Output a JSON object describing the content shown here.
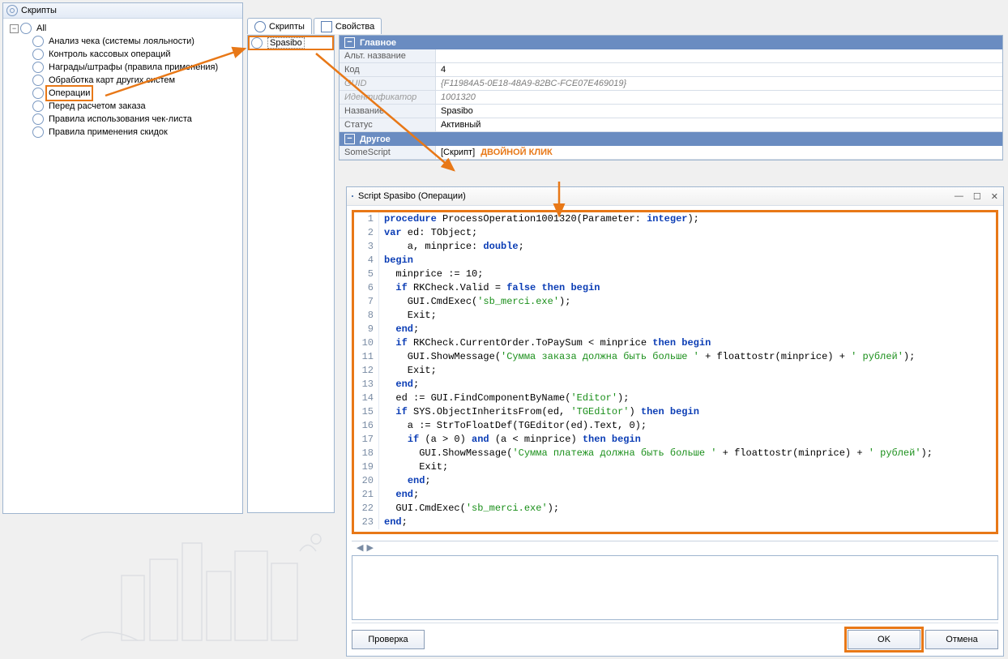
{
  "leftPanel": {
    "title": "Скрипты",
    "root": "All",
    "items": [
      "Анализ чека (системы лояльности)",
      "Контроль кассовых операций",
      "Награды/штрафы (правила применения)",
      "Обработка карт других систем",
      "Операции",
      "Перед расчетом заказа",
      "Правила использования чек-листа",
      "Правила применения скидок"
    ],
    "selectedIndex": 4
  },
  "tabs": {
    "scripts": "Скрипты",
    "properties": "Свойства"
  },
  "midPanel": {
    "item": "Spasibo"
  },
  "props": {
    "section_main": "Главное",
    "section_other": "Другое",
    "rows": {
      "alt_name_label": "Альт. название",
      "alt_name_value": "",
      "code_label": "Код",
      "code_value": "4",
      "guid_label": "GUID",
      "guid_value": "{F11984A5-0E18-48A9-82BC-FCE07E469019}",
      "id_label": "Идентификатор",
      "id_value": "1001320",
      "name_label": "Название",
      "name_value": "Spasibo",
      "status_label": "Статус",
      "status_value": "Активный",
      "somescript_label": "SomeScript",
      "somescript_value": "[Скрипт]",
      "dbl_click_hint": "ДВОЙНОЙ КЛИК"
    }
  },
  "dialog": {
    "title": "Script Spasibo (Операции)",
    "buttons": {
      "verify": "Проверка",
      "ok": "OK",
      "cancel": "Отмена"
    }
  },
  "code": [
    {
      "n": 1,
      "seg": [
        [
          "kw",
          "procedure"
        ],
        [
          "txt",
          " ProcessOperation1001320(Parameter: "
        ],
        [
          "kw",
          "integer"
        ],
        [
          "txt",
          ");"
        ]
      ]
    },
    {
      "n": 2,
      "seg": [
        [
          "kw",
          "var"
        ],
        [
          "txt",
          " ed: TObject;"
        ]
      ]
    },
    {
      "n": 3,
      "seg": [
        [
          "txt",
          "    a, minprice: "
        ],
        [
          "kw",
          "double"
        ],
        [
          "txt",
          ";"
        ]
      ]
    },
    {
      "n": 4,
      "seg": [
        [
          "kw",
          "begin"
        ]
      ]
    },
    {
      "n": 5,
      "seg": [
        [
          "txt",
          "  minprice := 10;"
        ]
      ]
    },
    {
      "n": 6,
      "seg": [
        [
          "txt",
          "  "
        ],
        [
          "kw",
          "if"
        ],
        [
          "txt",
          " RKCheck.Valid = "
        ],
        [
          "kw",
          "false"
        ],
        [
          "txt",
          " "
        ],
        [
          "kw",
          "then"
        ],
        [
          "txt",
          " "
        ],
        [
          "kw",
          "begin"
        ]
      ]
    },
    {
      "n": 7,
      "seg": [
        [
          "txt",
          "    GUI.CmdExec("
        ],
        [
          "str",
          "'sb_merci.exe'"
        ],
        [
          "txt",
          ");"
        ]
      ]
    },
    {
      "n": 8,
      "seg": [
        [
          "txt",
          "    Exit;"
        ]
      ]
    },
    {
      "n": 9,
      "seg": [
        [
          "txt",
          "  "
        ],
        [
          "kw",
          "end"
        ],
        [
          "txt",
          ";"
        ]
      ]
    },
    {
      "n": 10,
      "seg": [
        [
          "txt",
          "  "
        ],
        [
          "kw",
          "if"
        ],
        [
          "txt",
          " RKCheck.CurrentOrder.ToPaySum < minprice "
        ],
        [
          "kw",
          "then"
        ],
        [
          "txt",
          " "
        ],
        [
          "kw",
          "begin"
        ]
      ]
    },
    {
      "n": 11,
      "seg": [
        [
          "txt",
          "    GUI.ShowMessage("
        ],
        [
          "str",
          "'Сумма заказа должна быть больше '"
        ],
        [
          "txt",
          " + floattostr(minprice) + "
        ],
        [
          "str",
          "' рублей'"
        ],
        [
          "txt",
          ");"
        ]
      ]
    },
    {
      "n": 12,
      "seg": [
        [
          "txt",
          "    Exit;"
        ]
      ]
    },
    {
      "n": 13,
      "seg": [
        [
          "txt",
          "  "
        ],
        [
          "kw",
          "end"
        ],
        [
          "txt",
          ";"
        ]
      ]
    },
    {
      "n": 14,
      "seg": [
        [
          "txt",
          "  ed := GUI.FindComponentByName("
        ],
        [
          "str",
          "'Editor'"
        ],
        [
          "txt",
          ");"
        ]
      ]
    },
    {
      "n": 15,
      "seg": [
        [
          "txt",
          "  "
        ],
        [
          "kw",
          "if"
        ],
        [
          "txt",
          " SYS.ObjectInheritsFrom(ed, "
        ],
        [
          "str",
          "'TGEditor'"
        ],
        [
          "txt",
          ") "
        ],
        [
          "kw",
          "then"
        ],
        [
          "txt",
          " "
        ],
        [
          "kw",
          "begin"
        ]
      ]
    },
    {
      "n": 16,
      "seg": [
        [
          "txt",
          "    a := StrToFloatDef(TGEditor(ed).Text, 0);"
        ]
      ]
    },
    {
      "n": 17,
      "seg": [
        [
          "txt",
          "    "
        ],
        [
          "kw",
          "if"
        ],
        [
          "txt",
          " (a > 0) "
        ],
        [
          "kw",
          "and"
        ],
        [
          "txt",
          " (a < minprice) "
        ],
        [
          "kw",
          "then"
        ],
        [
          "txt",
          " "
        ],
        [
          "kw",
          "begin"
        ]
      ]
    },
    {
      "n": 18,
      "seg": [
        [
          "txt",
          "      GUI.ShowMessage("
        ],
        [
          "str",
          "'Сумма платежа должна быть больше '"
        ],
        [
          "txt",
          " + floattostr(minprice) + "
        ],
        [
          "str",
          "' рублей'"
        ],
        [
          "txt",
          ");"
        ]
      ]
    },
    {
      "n": 19,
      "seg": [
        [
          "txt",
          "      Exit;"
        ]
      ]
    },
    {
      "n": 20,
      "seg": [
        [
          "txt",
          "    "
        ],
        [
          "kw",
          "end"
        ],
        [
          "txt",
          ";"
        ]
      ]
    },
    {
      "n": 21,
      "seg": [
        [
          "txt",
          "  "
        ],
        [
          "kw",
          "end"
        ],
        [
          "txt",
          ";"
        ]
      ]
    },
    {
      "n": 22,
      "seg": [
        [
          "txt",
          "  GUI.CmdExec("
        ],
        [
          "str",
          "'sb_merci.exe'"
        ],
        [
          "txt",
          ");"
        ]
      ]
    },
    {
      "n": 23,
      "seg": [
        [
          "kw",
          "end"
        ],
        [
          "txt",
          ";"
        ]
      ]
    }
  ]
}
